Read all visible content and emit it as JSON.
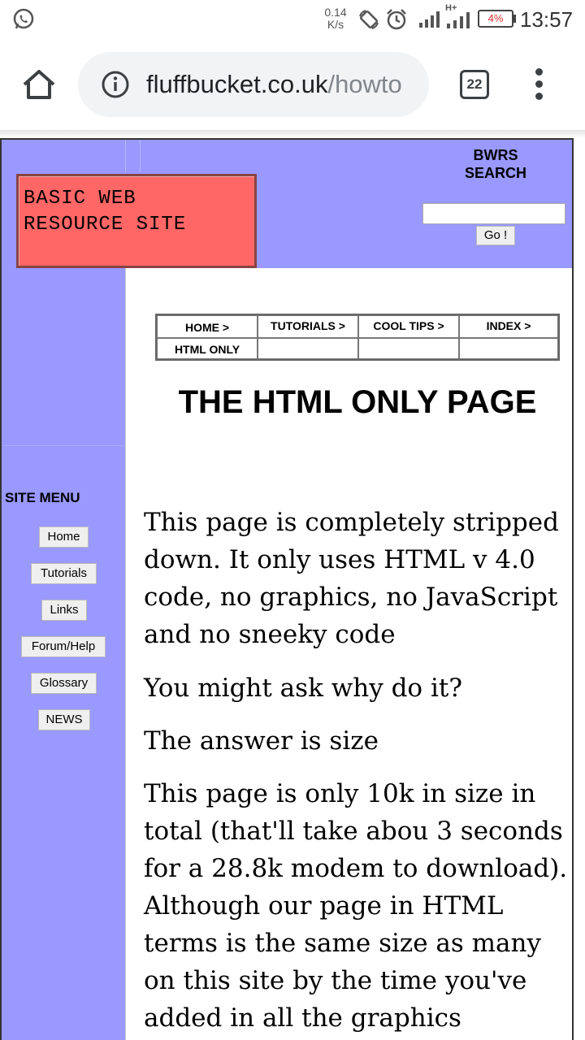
{
  "status_bar": {
    "speed_value": "0.14",
    "speed_unit": "K/s",
    "network_type": "H+",
    "battery": "4%",
    "time": "13:57",
    "icons": [
      "whatsapp-icon",
      "auto-rotate-icon",
      "alarm-icon",
      "signal-icon",
      "signal-hplus-icon",
      "battery-icon"
    ]
  },
  "browser": {
    "url_domain": "fluffbucket.co.uk",
    "url_path": "/howto",
    "tab_count": "22",
    "icons": [
      "home-icon",
      "info-icon",
      "tabs-icon",
      "more-vert-icon"
    ]
  },
  "site": {
    "logo_line1": "BASIC WEB",
    "logo_line2": "RESOURCE SITE",
    "search_title_line1": "BWRS",
    "search_title_line2": "SEARCH",
    "search_value": "",
    "go_label": "Go !",
    "colors": {
      "header_bg": "#9999ff",
      "logo_bg": "#ff6666"
    }
  },
  "sidebar": {
    "title": "SITE MENU",
    "items": [
      {
        "label": "Home"
      },
      {
        "label": "Tutorials"
      },
      {
        "label": "Links"
      },
      {
        "label": "Forum/Help"
      },
      {
        "label": "Glossary"
      },
      {
        "label": "NEWS"
      }
    ]
  },
  "nav": {
    "row1": [
      "HOME >",
      "TUTORIALS >",
      "COOL TIPS >",
      "INDEX >"
    ],
    "row2": [
      "HTML ONLY",
      "",
      "",
      ""
    ]
  },
  "main": {
    "title": "THE HTML ONLY PAGE",
    "para1": "This page is completely stripped down. It only uses HTML v 4.0 code, no graphics, no JavaScript and no sneeky code",
    "para2": "You might ask why do it?",
    "para3": "The answer is size",
    "para4": "This page is only 10k in size in total (that'll take abou 3 seconds for a 28.8k modem to download). Although our page in HTML terms is the same size as many on this site by the time you've added in all the graphics"
  }
}
